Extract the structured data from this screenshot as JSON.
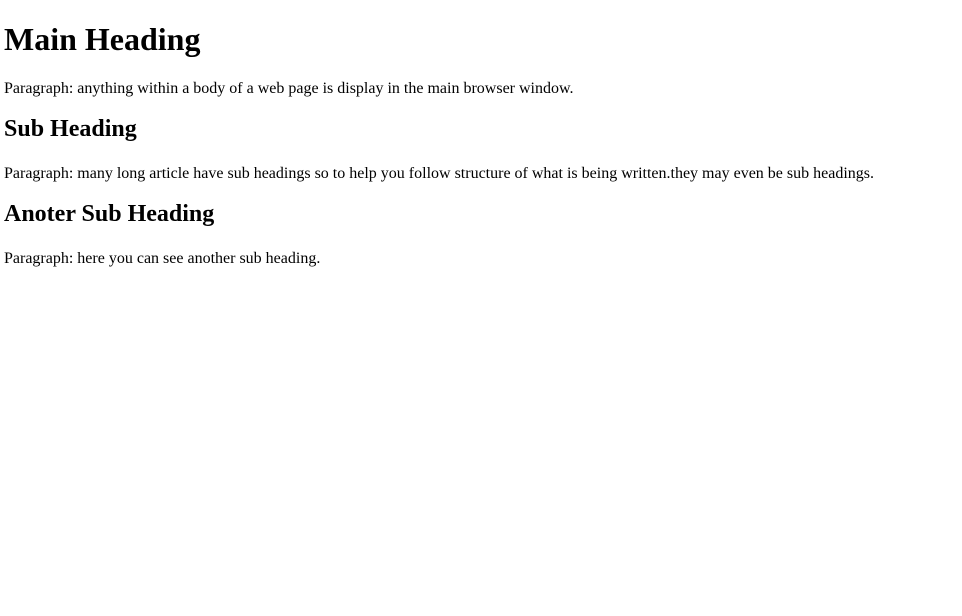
{
  "main_heading": "Main Heading",
  "paragraph_1": "Paragraph: anything within a body of a web page is display in the main browser window.",
  "sub_heading_1": "Sub Heading",
  "paragraph_2": "Paragraph: many long article have sub headings so to help you follow structure of what is being written.they may even be sub headings.",
  "sub_heading_2": "Anoter Sub Heading",
  "paragraph_3": "Paragraph: here you can see another sub heading."
}
